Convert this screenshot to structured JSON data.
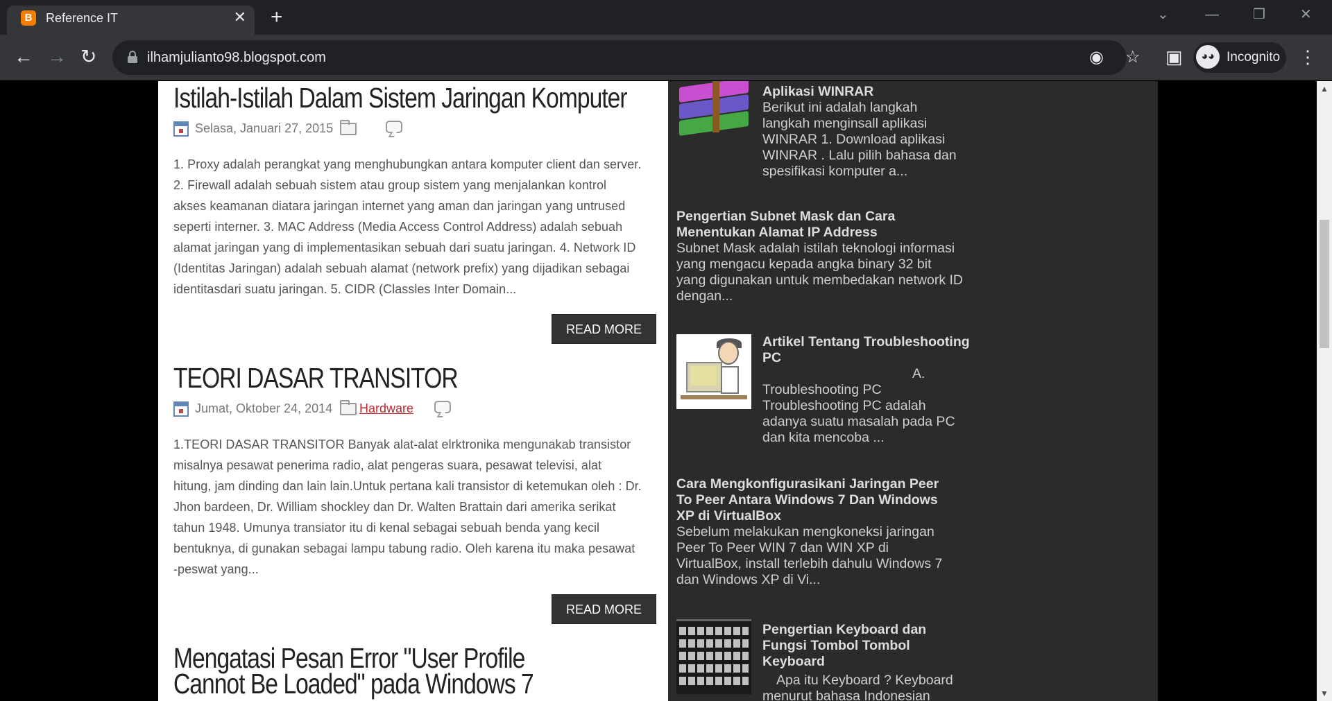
{
  "browser": {
    "tab_title": "Reference IT",
    "tab_favicon": "B",
    "tab_close": "✕",
    "new_tab": "+",
    "url": "ilhamjulianto98.blogspot.com",
    "incognito_label": "Incognito",
    "window_controls": {
      "tabsearch": "⌄",
      "minimize": "—",
      "restore": "❐",
      "close": "✕"
    },
    "icons": {
      "back": "←",
      "forward": "→",
      "reload": "↻",
      "eye_off": "◉",
      "star": "☆",
      "sidepanel": "▣",
      "menu": "⋮",
      "incognito": "◕◕"
    }
  },
  "posts": [
    {
      "title": "Istilah-Istilah Dalam Sistem Jaringan Komputer",
      "date": "Selasa, Januari 27, 2015",
      "label": "",
      "body": "1. Proxy adalah perangkat yang menghubungkan antara komputer client dan server. 2. Firewall adalah sebuah sistem atau group sistem yang menjalankan kontrol akses keamanan diatara jaringan internet yang aman dan jaringan yang untrused seperti interner. 3. MAC Address (Media Access Control Address) adalah sebuah alamat jaringan yang di implementasikan sebuah dari suatu jaringan. 4. Network ID (Identitas Jaringan) adalah sebuah alamat (network prefix) yang dijadikan sebagai identitasdari suatu jaringan. 5. CIDR (Classles Inter Domain...",
      "read_more": "READ MORE"
    },
    {
      "title": "TEORI DASAR TRANSITOR",
      "date": "Jumat, Oktober 24, 2014",
      "label": "Hardware",
      "body": "1.TEORI DASAR TRANSITOR      Banyak alat-alat elrktronika mengunakab transistor misalnya pesawat penerima radio, alat pengeras suara, pesawat televisi, alat hitung, jam dinding dan lain lain.Untuk pertana kali transistor di ketemukan oleh : Dr. Jhon bardeen, Dr. William shockley dan Dr. Walten Brattain dari amerika serikat tahun 1948.     Umunya transiator itu di kenal sebagai sebuah benda yang kecil bentuknya, di gunakan sebagai lampu tabung radio. Oleh karena itu maka pesawat -peswat yang...",
      "read_more": "READ MORE"
    },
    {
      "title": "Mengatasi Pesan Error \"User Profile Cannot Be Loaded\" pada Windows 7"
    }
  ],
  "sidebar": [
    {
      "title": "Aplikasi WINRAR",
      "snippet": "Berikut ini adalah langkah langkah menginsall aplikasi WINRAR 1. Download aplikasi WINRAR   . Lalu pilih bahasa dan spesifikasi komputer a...",
      "thumb": "winrar-icon"
    },
    {
      "title": "Pengertian Subnet Mask dan Cara Menentukan Alamat IP Address",
      "snippet": "Subnet Mask adalah istilah teknologi informasi yang mengacu kepada angka  binary 32 bit yang digunakan untuk membedakan network ID dengan..."
    },
    {
      "title": "Artikel Tentang Troubleshooting PC",
      "snippet": "A. Troubleshooting PC Troubleshooting PC adalah adanya suatu masalah pada PC dan kita mencoba ...",
      "thumb": "technician-image"
    },
    {
      "title": "Cara Mengkonfigurasikani Jaringan Peer To Peer Antara Windows 7 Dan Windows XP di VirtualBox",
      "snippet": "Sebelum melakukan mengkoneksi jaringan Peer To Peer WIN 7 dan WIN XP di VirtualBox, install terlebih dahulu Windows 7 dan Windows XP di Vi..."
    },
    {
      "title": "Pengertian Keyboard dan Fungsi Tombol Tombol Keyboard",
      "snippet": "Apa itu Keyboard ? Keyboard menurut bahasa Indonesian",
      "thumb": "keyboard-image"
    }
  ]
}
